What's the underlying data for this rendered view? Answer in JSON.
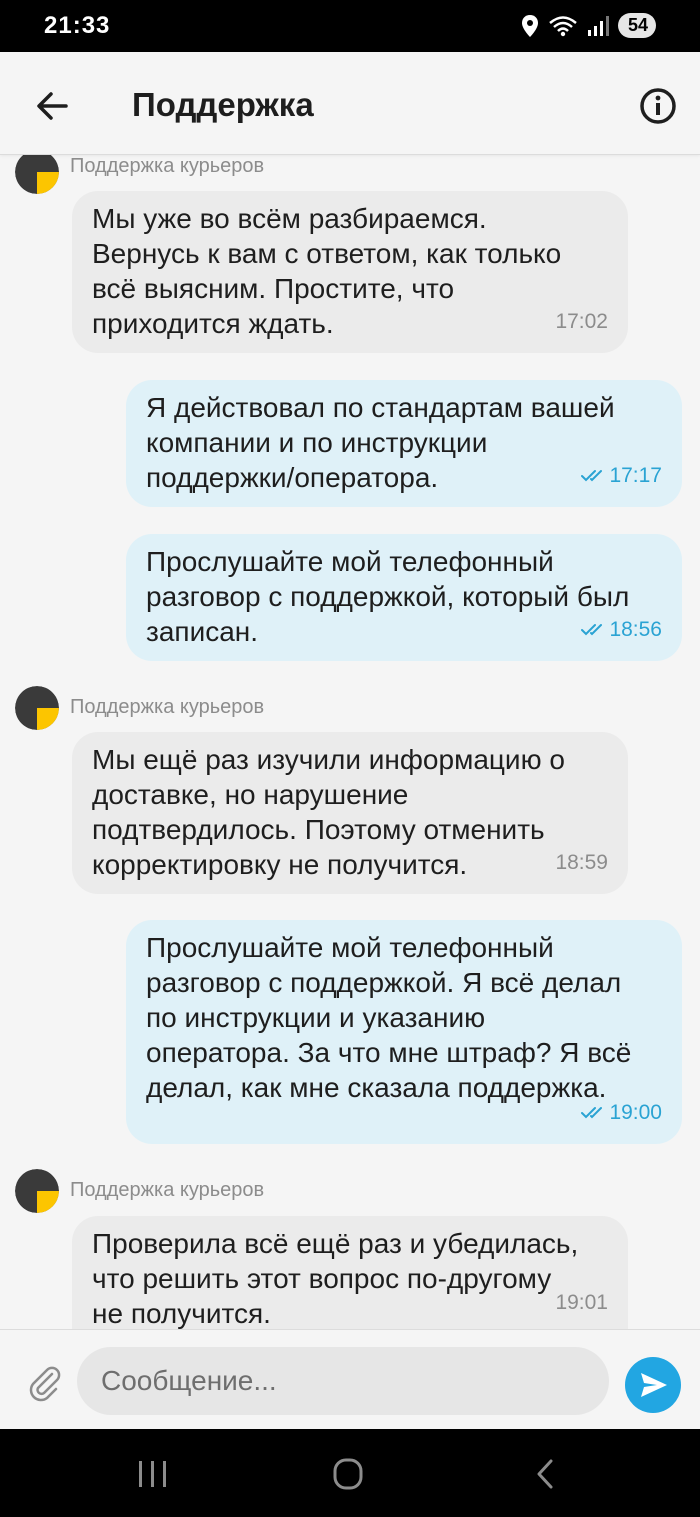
{
  "status_bar": {
    "time": "21:33",
    "battery": "54"
  },
  "header": {
    "title": "Поддержка"
  },
  "messages": [
    {
      "sender": "Поддержка курьеров",
      "text": "Мы уже во всём разбираемся.\nВернусь к вам с ответом, как только\nвсё выясним. Простите, что\nприходится ждать.",
      "time": "17:02"
    },
    {
      "text": "Я действовал по стандартам вашей\nкомпании и по инструкции\nподдержки/оператора.",
      "time": "17:17"
    },
    {
      "text": "Прослушайте мой телефонный\nразговор с поддержкой, который был\nзаписан.",
      "time": "18:56"
    },
    {
      "sender": "Поддержка курьеров",
      "text": "Мы ещё раз изучили информацию о\nдоставке, но нарушение\nподтвердилось. Поэтому отменить\nкорректировку не получится.",
      "time": "18:59"
    },
    {
      "text": "Прослушайте мой телефонный\nразговор с поддержкой. Я всё делал\nпо инструкции и указанию\nоператора. За что мне штраф? Я всё\nделал, как мне сказала поддержка.",
      "time": "19:00"
    },
    {
      "sender": "Поддержка курьеров",
      "text": "Проверила всё ещё раз и убедилась,\nчто решить этот вопрос по-другому\nне получится.",
      "time": "19:01"
    }
  ],
  "composer": {
    "placeholder": "Сообщение..."
  },
  "colors": {
    "accent": "#22a6e2",
    "incoming_bubble": "#ebebeb",
    "outgoing_bubble": "#dff1f8",
    "avatar_yellow": "#fcc500"
  }
}
